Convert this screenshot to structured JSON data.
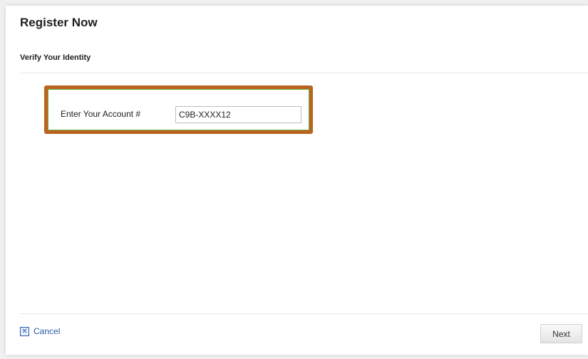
{
  "header": {
    "title": "Register Now",
    "subtitle": "Verify Your Identity"
  },
  "form": {
    "account_label": "Enter Your Account #",
    "account_value": "C9B-XXXX12"
  },
  "footer": {
    "cancel_label": "Cancel",
    "cancel_icon": "close-icon",
    "next_label": "Next"
  },
  "colors": {
    "highlight_border": "#b8631f",
    "link": "#2a5aa8"
  }
}
